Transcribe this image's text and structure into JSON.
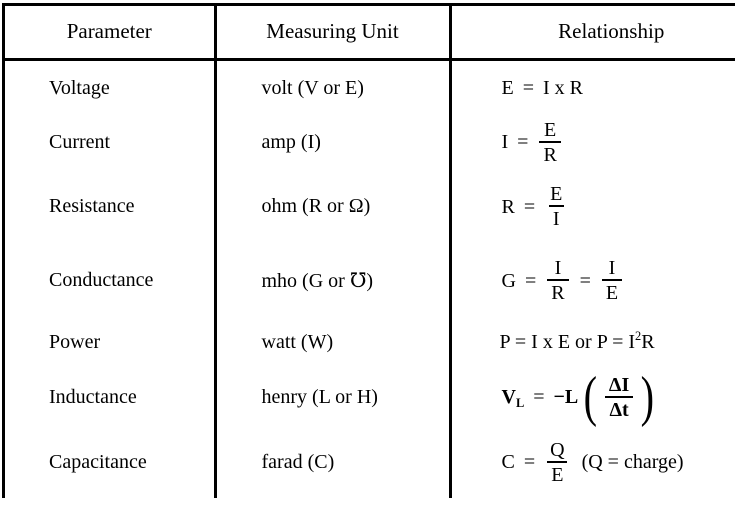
{
  "table": {
    "headers": [
      "Parameter",
      "Measuring Unit",
      "Relationship"
    ],
    "rows": [
      {
        "parameter": "Voltage",
        "unit": "volt (V or E)",
        "relationship_text": "E = I x R",
        "relationship": {
          "lhs": "E",
          "op": "=",
          "rhs": "I x R"
        }
      },
      {
        "parameter": "Current",
        "unit": "amp (I)",
        "relationship_text": "I = E / R",
        "relationship": {
          "lhs": "I",
          "op": "=",
          "numerator": "E",
          "denominator": "R"
        }
      },
      {
        "parameter": "Resistance",
        "unit": "ohm (R or Ω)",
        "relationship_text": "R = E / I",
        "relationship": {
          "lhs": "R",
          "op": "=",
          "numerator": "E",
          "denominator": "I"
        }
      },
      {
        "parameter": "Conductance",
        "unit": "mho (G or ℧)",
        "relationship_text": "G = I / R = I / E",
        "relationship": {
          "lhs": "G",
          "op": "=",
          "numerator": "I",
          "denominator": "R",
          "op2": "=",
          "numerator2": "I",
          "denominator2": "E"
        }
      },
      {
        "parameter": "Power",
        "unit": "watt (W)",
        "relationship_text": "P = I x E or P = I²R",
        "relationship": {
          "part1": "P = I x E or P = I",
          "exponent": "2",
          "part2": "R"
        }
      },
      {
        "parameter": "Inductance",
        "unit": "henry (L or H)",
        "relationship_text": "V_L = −L (ΔI / Δt)",
        "relationship": {
          "lhs": "V",
          "lhs_subscript": "L",
          "op": "=",
          "coefficient": "−L",
          "paren_open": "(",
          "numerator": "ΔI",
          "denominator": "Δt",
          "paren_close": ")"
        }
      },
      {
        "parameter": "Capacitance",
        "unit": "farad (C)",
        "relationship_text": "C = Q / E  (Q = charge)",
        "relationship": {
          "lhs": "C",
          "op": "=",
          "numerator": "Q",
          "denominator": "E",
          "note": "(Q  =  charge)"
        }
      }
    ]
  },
  "style": {
    "border_color": "#000000",
    "text_color": "#000000",
    "background": "#ffffff"
  }
}
